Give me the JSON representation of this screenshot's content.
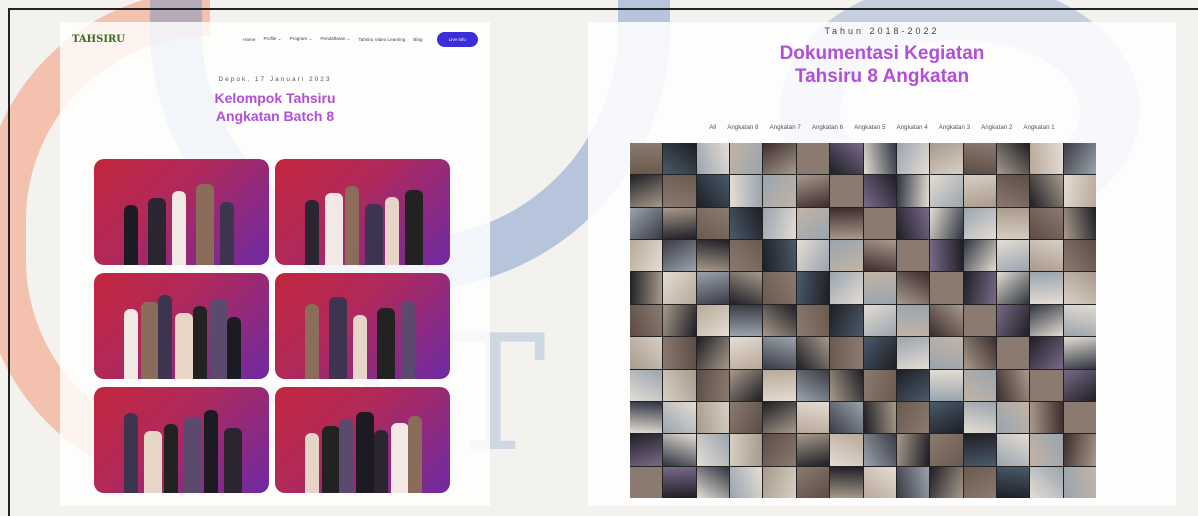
{
  "left_page": {
    "logo": "TAHSIRU",
    "nav": [
      "Home",
      "Profile ⌄",
      "Program ⌄",
      "Pendaftaran ⌄",
      "Tahsiru Video Learning",
      "Blog"
    ],
    "cta": "Live Info",
    "date": "Depok, 17 Januari 2023",
    "title_line1": "Kelompok Tahsiru",
    "title_line2": "Angkatan Batch 8"
  },
  "right_page": {
    "year": "Tahun 2018-2022",
    "title_line1": "Dokumentasi Kegiatan",
    "title_line2": "Tahsiru 8 Angkatan",
    "filters": [
      "All",
      "Angkatan 8",
      "Angkatan 7",
      "Angkatan 6",
      "Angkatan 5",
      "Angkatan 4",
      "Angkatan 3",
      "Angkatan 2",
      "Angkatan 1"
    ]
  },
  "watermark": "STT",
  "colors": {
    "accent": "#3b2dd8",
    "title": "#b14fd8",
    "photo_bg_start": "#c3263d",
    "photo_bg_end": "#6d2aa3"
  }
}
